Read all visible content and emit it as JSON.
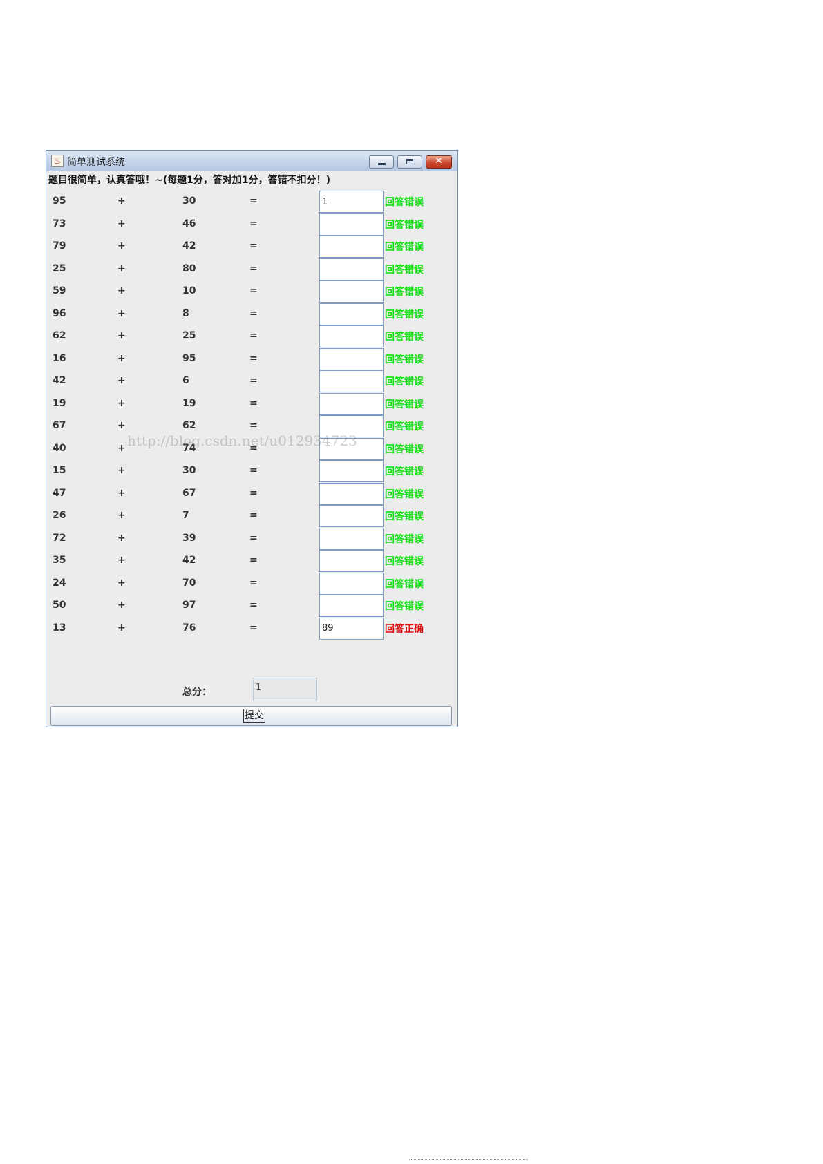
{
  "window": {
    "title": "简单测试系统",
    "header": "题目很简单，认真答哦！~(每题1分，答对加1分，答错不扣分！)"
  },
  "colors": {
    "wrong": "#11e011",
    "correct": "#e01010"
  },
  "questions": [
    {
      "a": "95",
      "op": "+",
      "b": "30",
      "eq": "=",
      "answer": "1",
      "result": "回答错误",
      "status": "wrong"
    },
    {
      "a": "73",
      "op": "+",
      "b": "46",
      "eq": "=",
      "answer": "",
      "result": "回答错误",
      "status": "wrong"
    },
    {
      "a": "79",
      "op": "+",
      "b": "42",
      "eq": "=",
      "answer": "",
      "result": "回答错误",
      "status": "wrong"
    },
    {
      "a": "25",
      "op": "+",
      "b": "80",
      "eq": "=",
      "answer": "",
      "result": "回答错误",
      "status": "wrong"
    },
    {
      "a": "59",
      "op": "+",
      "b": "10",
      "eq": "=",
      "answer": "",
      "result": "回答错误",
      "status": "wrong"
    },
    {
      "a": "96",
      "op": "+",
      "b": "8",
      "eq": "=",
      "answer": "",
      "result": "回答错误",
      "status": "wrong"
    },
    {
      "a": "62",
      "op": "+",
      "b": "25",
      "eq": "=",
      "answer": "",
      "result": "回答错误",
      "status": "wrong"
    },
    {
      "a": "16",
      "op": "+",
      "b": "95",
      "eq": "=",
      "answer": "",
      "result": "回答错误",
      "status": "wrong"
    },
    {
      "a": "42",
      "op": "+",
      "b": "6",
      "eq": "=",
      "answer": "",
      "result": "回答错误",
      "status": "wrong"
    },
    {
      "a": "19",
      "op": "+",
      "b": "19",
      "eq": "=",
      "answer": "",
      "result": "回答错误",
      "status": "wrong"
    },
    {
      "a": "67",
      "op": "+",
      "b": "62",
      "eq": "=",
      "answer": "",
      "result": "回答错误",
      "status": "wrong"
    },
    {
      "a": "40",
      "op": "+",
      "b": "74",
      "eq": "=",
      "answer": "",
      "result": "回答错误",
      "status": "wrong"
    },
    {
      "a": "15",
      "op": "+",
      "b": "30",
      "eq": "=",
      "answer": "",
      "result": "回答错误",
      "status": "wrong"
    },
    {
      "a": "47",
      "op": "+",
      "b": "67",
      "eq": "=",
      "answer": "",
      "result": "回答错误",
      "status": "wrong"
    },
    {
      "a": "26",
      "op": "+",
      "b": "7",
      "eq": "=",
      "answer": "",
      "result": "回答错误",
      "status": "wrong"
    },
    {
      "a": "72",
      "op": "+",
      "b": "39",
      "eq": "=",
      "answer": "",
      "result": "回答错误",
      "status": "wrong"
    },
    {
      "a": "35",
      "op": "+",
      "b": "42",
      "eq": "=",
      "answer": "",
      "result": "回答错误",
      "status": "wrong"
    },
    {
      "a": "24",
      "op": "+",
      "b": "70",
      "eq": "=",
      "answer": "",
      "result": "回答错误",
      "status": "wrong"
    },
    {
      "a": "50",
      "op": "+",
      "b": "97",
      "eq": "=",
      "answer": "",
      "result": "回答错误",
      "status": "wrong"
    },
    {
      "a": "13",
      "op": "+",
      "b": "76",
      "eq": "=",
      "answer": "89",
      "result": "回答正确",
      "status": "correct"
    }
  ],
  "total": {
    "label": "总分：",
    "value": "1"
  },
  "submit": {
    "label": "提交"
  },
  "watermark": "http://blog.csdn.net/u012934723"
}
